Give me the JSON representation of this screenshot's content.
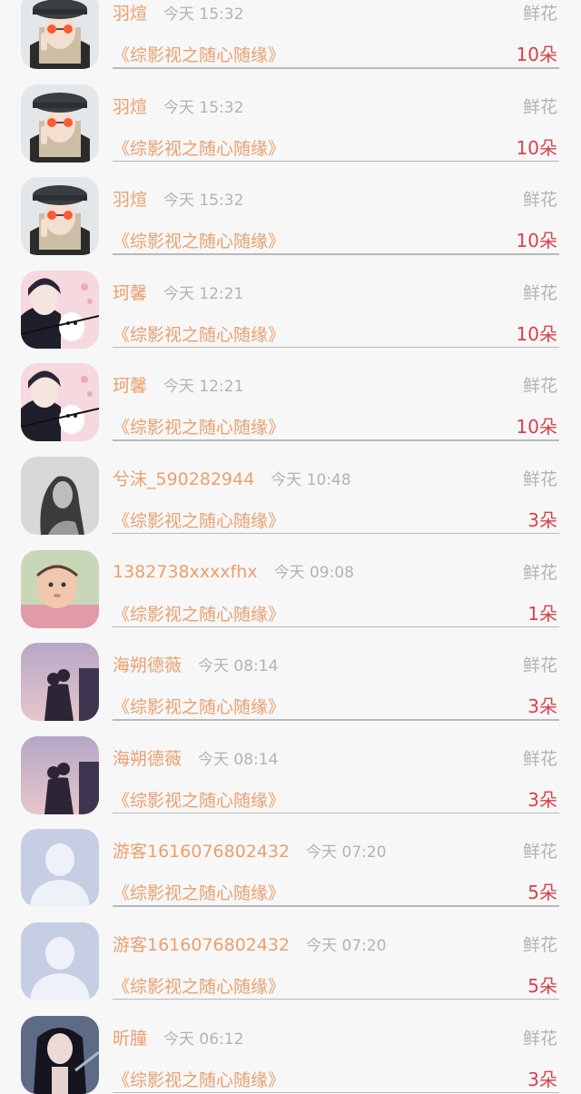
{
  "rows": [
    {
      "username": "羽煊",
      "time": "今天 15:32",
      "gift_type": "鲜花",
      "book": "《综影视之随心随缘》",
      "count": "10朵",
      "avatar": "avatar-cap-girl"
    },
    {
      "username": "羽煊",
      "time": "今天 15:32",
      "gift_type": "鲜花",
      "book": "《综影视之随心随缘》",
      "count": "10朵",
      "avatar": "avatar-cap-girl"
    },
    {
      "username": "羽煊",
      "time": "今天 15:32",
      "gift_type": "鲜花",
      "book": "《综影视之随心随缘》",
      "count": "10朵",
      "avatar": "avatar-cap-girl"
    },
    {
      "username": "珂馨",
      "time": "今天 12:21",
      "gift_type": "鲜花",
      "book": "《综影视之随心随缘》",
      "count": "10朵",
      "avatar": "avatar-anime-couple"
    },
    {
      "username": "珂馨",
      "time": "今天 12:21",
      "gift_type": "鲜花",
      "book": "《综影视之随心随缘》",
      "count": "10朵",
      "avatar": "avatar-anime-couple"
    },
    {
      "username": "兮沫_590282944",
      "time": "今天 10:48",
      "gift_type": "鲜花",
      "book": "《综影视之随心随缘》",
      "count": "3朵",
      "avatar": "avatar-grey-girl"
    },
    {
      "username": "1382738xxxxfhx",
      "time": "今天 09:08",
      "gift_type": "鲜花",
      "book": "《综影视之随心随缘》",
      "count": "1朵",
      "avatar": "avatar-baby"
    },
    {
      "username": "海朔德薇",
      "time": "今天 08:14",
      "gift_type": "鲜花",
      "book": "《综影视之随心随缘》",
      "count": "3朵",
      "avatar": "avatar-silhouette-couple"
    },
    {
      "username": "海朔德薇",
      "time": "今天 08:14",
      "gift_type": "鲜花",
      "book": "《综影视之随心随缘》",
      "count": "3朵",
      "avatar": "avatar-silhouette-couple"
    },
    {
      "username": "游客1616076802432",
      "time": "今天 07:20",
      "gift_type": "鲜花",
      "book": "《综影视之随心随缘》",
      "count": "5朵",
      "avatar": "avatar-default"
    },
    {
      "username": "游客1616076802432",
      "time": "今天 07:20",
      "gift_type": "鲜花",
      "book": "《综影视之随心随缘》",
      "count": "5朵",
      "avatar": "avatar-default"
    },
    {
      "username": "昕朣",
      "time": "今天 06:12",
      "gift_type": "鲜花",
      "book": "《综影视之随心随缘》",
      "count": "3朵",
      "avatar": "avatar-dark-hair-girl"
    }
  ],
  "colors": {
    "background": "#f7f7f7",
    "username": "#e8a070",
    "book_title": "#e8a070",
    "timestamp": "#b3b3b3",
    "gift_type": "#b3b3b3",
    "count": "#d9414b",
    "divider": "#b9b9b9"
  }
}
